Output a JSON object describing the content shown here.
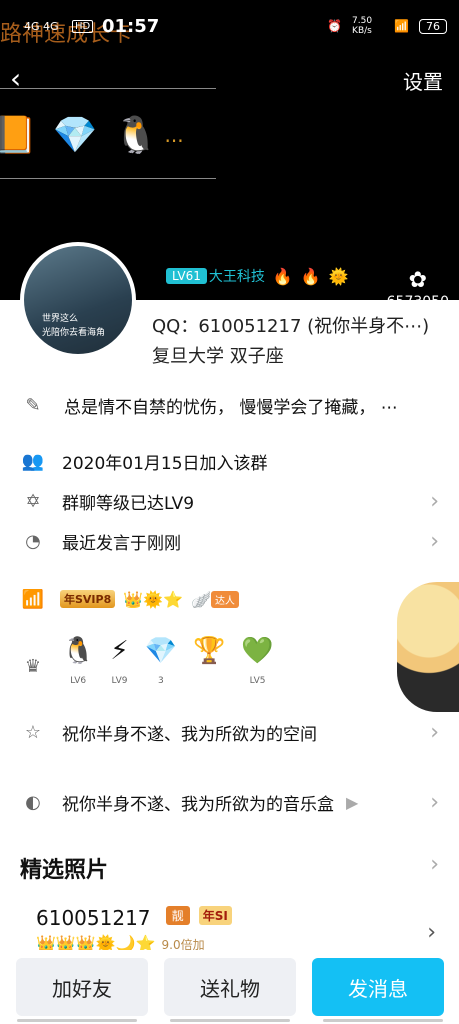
{
  "status_bar": {
    "overlay_text": "路神速成长卡",
    "signal": "4G 4G",
    "hd": "HD",
    "time": "01:57",
    "alarm_icon": "alarm-icon",
    "speed": "7.50 KB/s",
    "battery": "76"
  },
  "header": {
    "settings_label": "设置",
    "medals": [
      "book-medal-icon",
      "diamond-medal-icon",
      "penguin-crown-medal-icon"
    ],
    "more": "..."
  },
  "profile": {
    "level_badge": "LV61",
    "name": "大王科技",
    "extra_icons": [
      "fire-icon",
      "flame-icon",
      "sun-icon"
    ],
    "score_icon": "flower-icon",
    "score": "6573050",
    "avatar_text_line1": "世界这么",
    "avatar_text_line2": "光陪你去看海角",
    "qq": "QQ：610051217 (祝你半身不⋯)",
    "school": "复旦大学 双子座"
  },
  "rows": {
    "signature": "总是情不自禁的忧伤， 慢慢学会了掩藏， ⋯",
    "join_date": "2020年01月15日加入该群",
    "group_level": "群聊等级已达LV9",
    "last_speak": "最近发言于刚刚",
    "space": "祝你半身不遂、我为所欲为的空间",
    "music": "祝你半身不遂、我为所欲为的音乐盒"
  },
  "vip": {
    "svip_label": "年SVIP8",
    "extra": "达人"
  },
  "level_icons": [
    {
      "icon": "qq-penguin-icon",
      "label": "LV6"
    },
    {
      "icon": "lightning-icon",
      "label": "LV9"
    },
    {
      "icon": "ruby-icon",
      "label": "3"
    },
    {
      "icon": "trophy-icon",
      "label": ""
    },
    {
      "icon": "green-diamond-icon",
      "label": "LV5"
    }
  ],
  "photos": {
    "title": "精选照片"
  },
  "card": {
    "qqnum": "610051217",
    "pretty": "靓",
    "year": "年SI",
    "multiplier": "9.0倍加"
  },
  "buttons": {
    "add_friend": "加好友",
    "send_gift": "送礼物",
    "send_message": "发消息"
  }
}
